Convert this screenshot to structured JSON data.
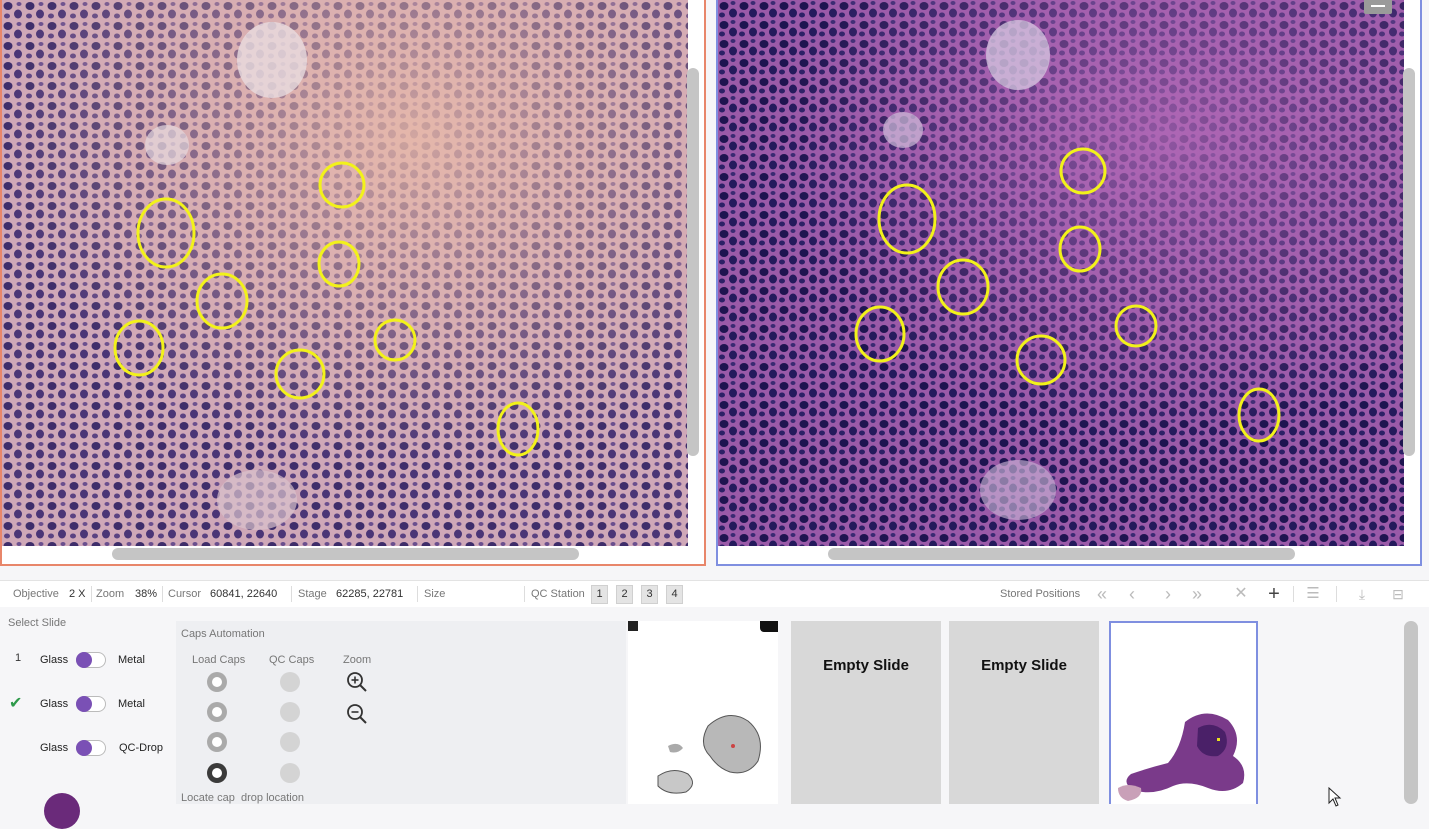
{
  "status": {
    "objective_label": "Objective",
    "objective_value": "2 X",
    "zoom_label": "Zoom",
    "zoom_value": "38%",
    "cursor_label": "Cursor",
    "cursor_value": "60841, 22640",
    "stage_label": "Stage",
    "stage_value": "62285, 22781",
    "size_label": "Size",
    "qc_station_label": "QC Station",
    "qc_stations": [
      "1",
      "2",
      "3",
      "4"
    ],
    "stored_positions_label": "Stored Positions"
  },
  "select_slide": {
    "title": "Select Slide",
    "rows": [
      {
        "marker": "1",
        "left": "Glass",
        "right": "Metal"
      },
      {
        "marker": "✔",
        "left": "Glass",
        "right": "Metal"
      },
      {
        "marker": "",
        "left": "Glass",
        "right": "QC-Drop"
      }
    ]
  },
  "caps": {
    "title": "Caps Automation",
    "load_caps": "Load Caps",
    "qc_caps": "QC Caps",
    "zoom": "Zoom",
    "locate_cap": "Locate cap",
    "drop_location": "drop location"
  },
  "thumbnails": {
    "empty_label_1": "Empty Slide",
    "empty_label_2": "Empty Slide"
  },
  "colors": {
    "annotation": "#f2f21a",
    "left_border": "#e8866a",
    "right_border": "#7f8fe0",
    "toggle": "#7a50b5"
  }
}
